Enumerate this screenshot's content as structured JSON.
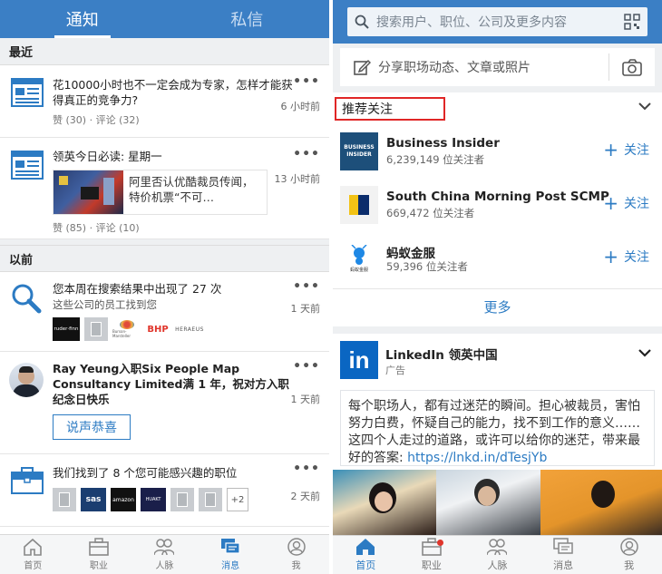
{
  "left": {
    "tabs": [
      {
        "label": "通知",
        "active": true
      },
      {
        "label": "私信",
        "active": false
      }
    ],
    "sections": {
      "recent": "最近",
      "earlier": "以前"
    },
    "notifications": [
      {
        "icon": "article-icon",
        "title": "花10000小时也不一定会成为专家，怎样才能获得真正的竞争力?",
        "meta": "赞 (30) · 评论 (32)",
        "time": "6 小时前"
      },
      {
        "icon": "article-icon",
        "title": "领英今日必读: 星期一",
        "preview": "阿里否认优酷裁员传闻，特价机票“不可…",
        "meta": "赞 (85) · 评论 (10)",
        "time": "13 小时前"
      },
      {
        "icon": "magnifier-icon",
        "title": "您本周在搜索结果中出现了 27 次",
        "subtitle": "这些公司的员工找到您",
        "logos": [
          "ruder·finn",
          "",
          "Burson-Marsteller",
          "BHP",
          "HERAEUS"
        ],
        "time": "1 天前"
      },
      {
        "icon": "avatar",
        "title": "Ray Yeung入职Six People Map Consultancy Limited满 1 年，祝对方入职纪念日快乐",
        "button": "说声恭喜",
        "time": "1 天前"
      },
      {
        "icon": "briefcase-icon",
        "title": "我们找到了 8 个您可能感兴趣的职位",
        "logos": [
          "",
          "sas",
          "amazon",
          "HUAKT",
          "",
          ""
        ],
        "more": "+2",
        "time": "2 天前"
      }
    ],
    "nav": [
      {
        "label": "首页",
        "icon": "home-icon",
        "active": false
      },
      {
        "label": "职业",
        "icon": "briefcase-icon",
        "active": false
      },
      {
        "label": "人脉",
        "icon": "people-icon",
        "active": false
      },
      {
        "label": "消息",
        "icon": "message-icon",
        "active": true
      },
      {
        "label": "我",
        "icon": "profile-icon",
        "active": false
      }
    ]
  },
  "right": {
    "search": {
      "placeholder": "搜索用户、职位、公司及更多内容"
    },
    "share": {
      "text": "分享职场动态、文章或照片"
    },
    "recommend": {
      "title": "推荐关注",
      "items": [
        {
          "name": "Business Insider",
          "followers": "6,239,149 位关注者",
          "follow": "关注",
          "logo_text": "BUSINESS INSIDER"
        },
        {
          "name": "South China Morning Post SCMP",
          "followers": "669,472 位关注者",
          "follow": "关注"
        },
        {
          "name": "蚂蚁金服",
          "followers": "59,396 位关注者",
          "follow": "关注",
          "logo_text": "蚂蚁金服"
        }
      ],
      "more": "更多"
    },
    "linkedin_card": {
      "logo": "in",
      "name": "LinkedIn 领英中国",
      "ad_label": "广告",
      "body": "每个职场人，都有过迷茫的瞬间。担心被裁员，害怕努力白费，怀疑自己的能力，找不到工作的意义……这四个人走过的道路，或许可以给你的迷茫，带来最好的答案: ",
      "link": "https://lnkd.in/dTesjYb"
    },
    "nav": [
      {
        "label": "首页",
        "icon": "home-icon",
        "active": true
      },
      {
        "label": "职业",
        "icon": "briefcase-icon",
        "active": false
      },
      {
        "label": "人脉",
        "icon": "people-icon",
        "active": false
      },
      {
        "label": "消息",
        "icon": "message-icon",
        "active": false
      },
      {
        "label": "我",
        "icon": "profile-icon",
        "active": false
      }
    ]
  }
}
